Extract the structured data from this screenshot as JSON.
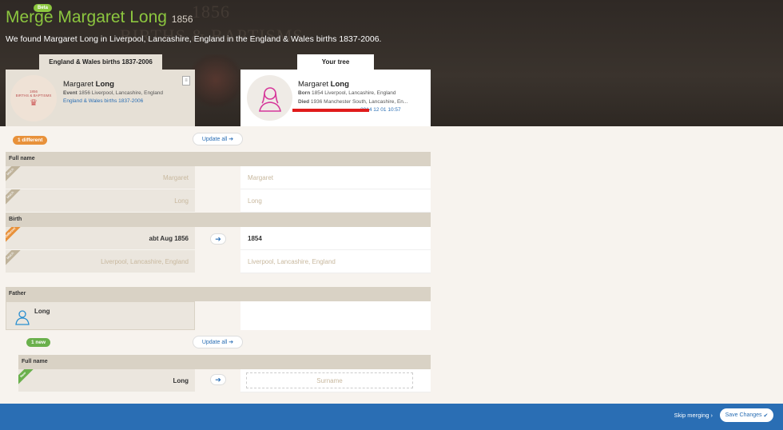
{
  "header": {
    "beta": "Beta",
    "title": "Merge Margaret Long",
    "year": "1856",
    "subtitle": "We found Margaret Long in Liverpool, Lancashire, England in the England & Wales births 1837-2006.",
    "watermark_1": "1856",
    "watermark_2": "BIRTHS & BAPTISMS"
  },
  "tabs": {
    "source": "England & Wales births 1837-2006",
    "tree": "Your tree"
  },
  "source_card": {
    "badge_line1": "1856",
    "badge_line2": "BIRTHS & BAPTISMS",
    "first": "Margaret",
    "last": "Long",
    "event_label": "Event",
    "event_value": "1856 Liverpool, Lancashire, England",
    "link": "England & Wales births 1837-2006"
  },
  "tree_card": {
    "first": "Margaret",
    "last": "Long",
    "born_label": "Born",
    "born_value": "1854 Liverpool, Lancashire, England",
    "died_label": "Died",
    "died_value": "1936 Manchester South, Lancashire, En...",
    "modified": "2014 12 01 10:57"
  },
  "summary": {
    "different": "1 different",
    "update_all": "Update all"
  },
  "sections": {
    "full_name": "Full name",
    "birth": "Birth",
    "father": "Father",
    "child_full_name": "Full name"
  },
  "rows": {
    "given": {
      "flag": "Match",
      "left": "Margaret",
      "right": "Margaret"
    },
    "surname": {
      "flag": "Match",
      "left": "Long",
      "right": "Long"
    },
    "birth_date": {
      "flag": "Different",
      "left": "abt Aug 1856",
      "right": "1854"
    },
    "birth_place": {
      "flag": "Match",
      "left": "Liverpool, Lancashire, England",
      "right": "Liverpool, Lancashire, England"
    }
  },
  "father": {
    "name": "Long",
    "new_count": "1 new",
    "update_all": "Update all",
    "flag": "New",
    "surname_value": "Long",
    "surname_placeholder": "Surname"
  },
  "footer": {
    "skip": "Skip merging",
    "save": "Save Changes"
  },
  "colors": {
    "accent_green": "#8cc63f",
    "accent_orange": "#e8913a",
    "footer_blue": "#2a6eb4",
    "redaction": "#e01b1b"
  }
}
